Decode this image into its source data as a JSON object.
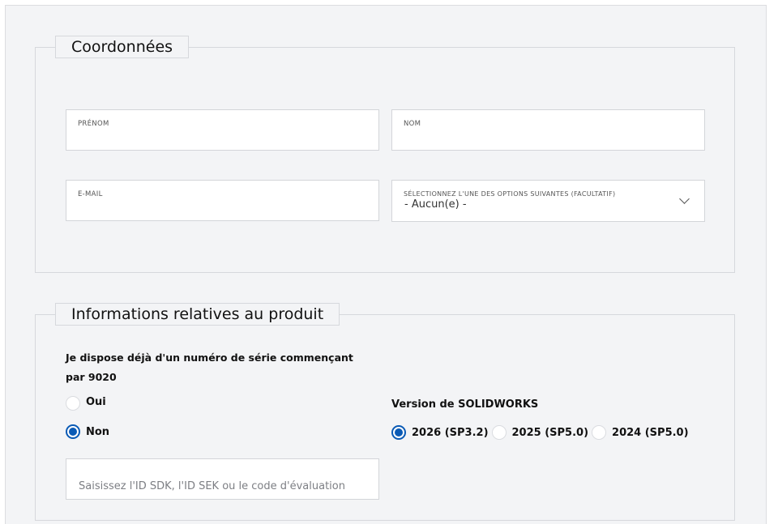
{
  "contact_section": {
    "legend": "Coordonnées",
    "first_name_label": "PRÉNOM",
    "last_name_label": "NOM",
    "email_label": "E-MAIL",
    "select_label": "SÉLECTIONNEZ L'UNE DES OPTIONS SUIVANTES (FACULTATIF)",
    "select_value": "- Aucun(e) -",
    "select_icon": "chevron-down-icon"
  },
  "product_section": {
    "legend": "Informations relatives au produit",
    "serial_question": "Je dispose déjà d'un numéro de série commençant par 9020",
    "serial_options": [
      {
        "label": "Oui",
        "checked": false
      },
      {
        "label": "Non",
        "checked": true
      }
    ],
    "code_placeholder": "Saisissez l'ID SDK, l'ID SEK ou le code d'évaluation",
    "version_title": "Version de SOLIDWORKS",
    "versions": [
      {
        "label": "2026 (SP3.2)",
        "checked": true
      },
      {
        "label": "2025 (SP5.0)",
        "checked": false
      },
      {
        "label": "2024 (SP5.0)",
        "checked": false
      }
    ]
  },
  "colors": {
    "panel_background": "#f3f4f6",
    "border": "#d6d8dc",
    "accent": "#0a5ab5"
  }
}
